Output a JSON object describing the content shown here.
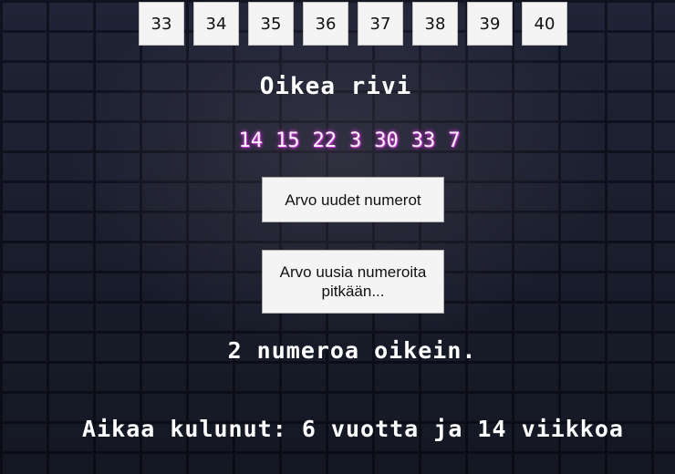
{
  "number_grid": [
    "33",
    "34",
    "35",
    "36",
    "37",
    "38",
    "39",
    "40"
  ],
  "correct_section": {
    "title": "Oikea rivi",
    "numbers": [
      "14",
      "15",
      "22",
      "3",
      "30",
      "33",
      "7"
    ]
  },
  "buttons": {
    "draw_new": "Arvo uudet numerot",
    "draw_long": "Arvo uusia numeroita pitkään..."
  },
  "result_text": "2 numeroa oikein.",
  "elapsed_text": "Aikaa kulunut: 6 vuotta ja 14 viikkoa",
  "colors": {
    "background": "#1f2436",
    "number_glow": "#d13bd6",
    "button_bg": "#f4f4f4"
  }
}
